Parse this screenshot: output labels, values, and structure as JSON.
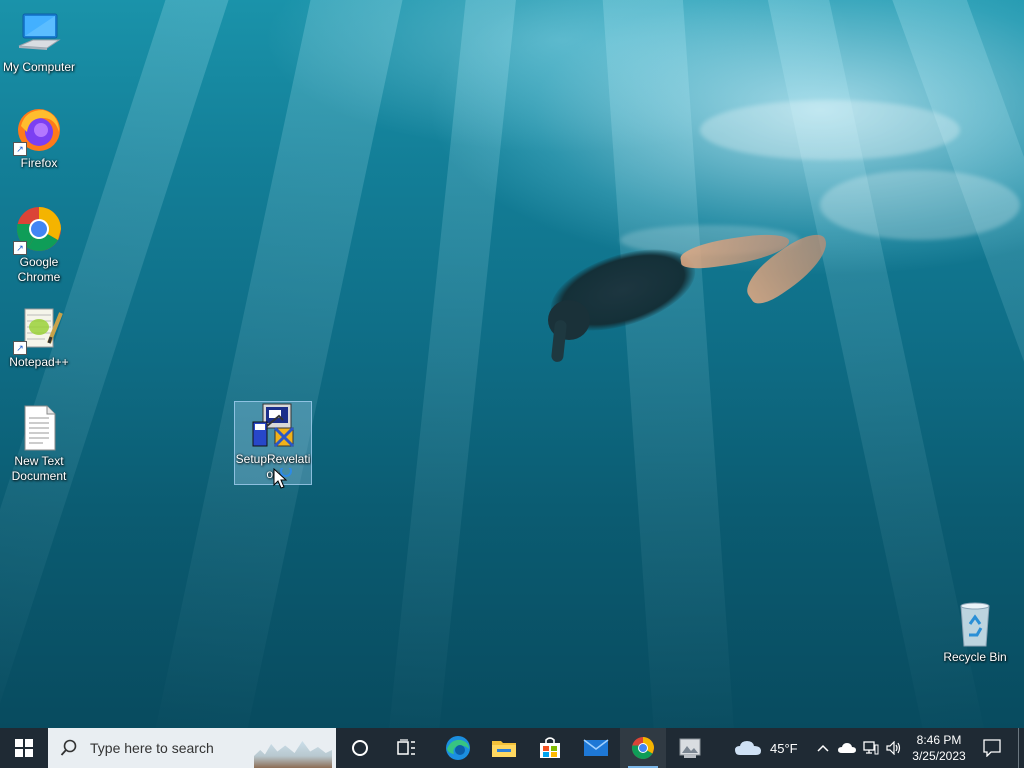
{
  "desktop": {
    "icons": [
      {
        "label": "My Computer",
        "icon": "computer-icon"
      },
      {
        "label": "Firefox",
        "icon": "firefox-icon"
      },
      {
        "label": "Google Chrome",
        "icon": "chrome-icon"
      },
      {
        "label": "Notepad++",
        "icon": "notepadpp-icon"
      },
      {
        "label": "New Text Document",
        "icon": "text-document-icon"
      },
      {
        "label": "SetupRevelation",
        "icon": "installer-icon",
        "selected": true
      },
      {
        "label": "Recycle Bin",
        "icon": "recycle-bin-icon"
      }
    ]
  },
  "taskbar": {
    "search_placeholder": "Type here to search",
    "pinned": [
      {
        "name": "cortana",
        "icon": "cortana-circle-icon"
      },
      {
        "name": "task-view",
        "icon": "task-view-icon"
      },
      {
        "name": "edge",
        "icon": "edge-icon"
      },
      {
        "name": "file-explorer",
        "icon": "folder-icon"
      },
      {
        "name": "microsoft-store",
        "icon": "store-bag-icon"
      },
      {
        "name": "mail",
        "icon": "mail-icon"
      },
      {
        "name": "chrome",
        "icon": "chrome-icon",
        "active": true
      },
      {
        "name": "app",
        "icon": "photos-app-icon"
      }
    ],
    "weather": {
      "temp": "45°F",
      "icon": "cloud-icon"
    },
    "clock": {
      "time": "8:46 PM",
      "date": "3/25/2023"
    }
  },
  "colors": {
    "taskbar": "#1f2a34",
    "search_box": "#e9eef2",
    "accent": "#7ab6e8"
  }
}
